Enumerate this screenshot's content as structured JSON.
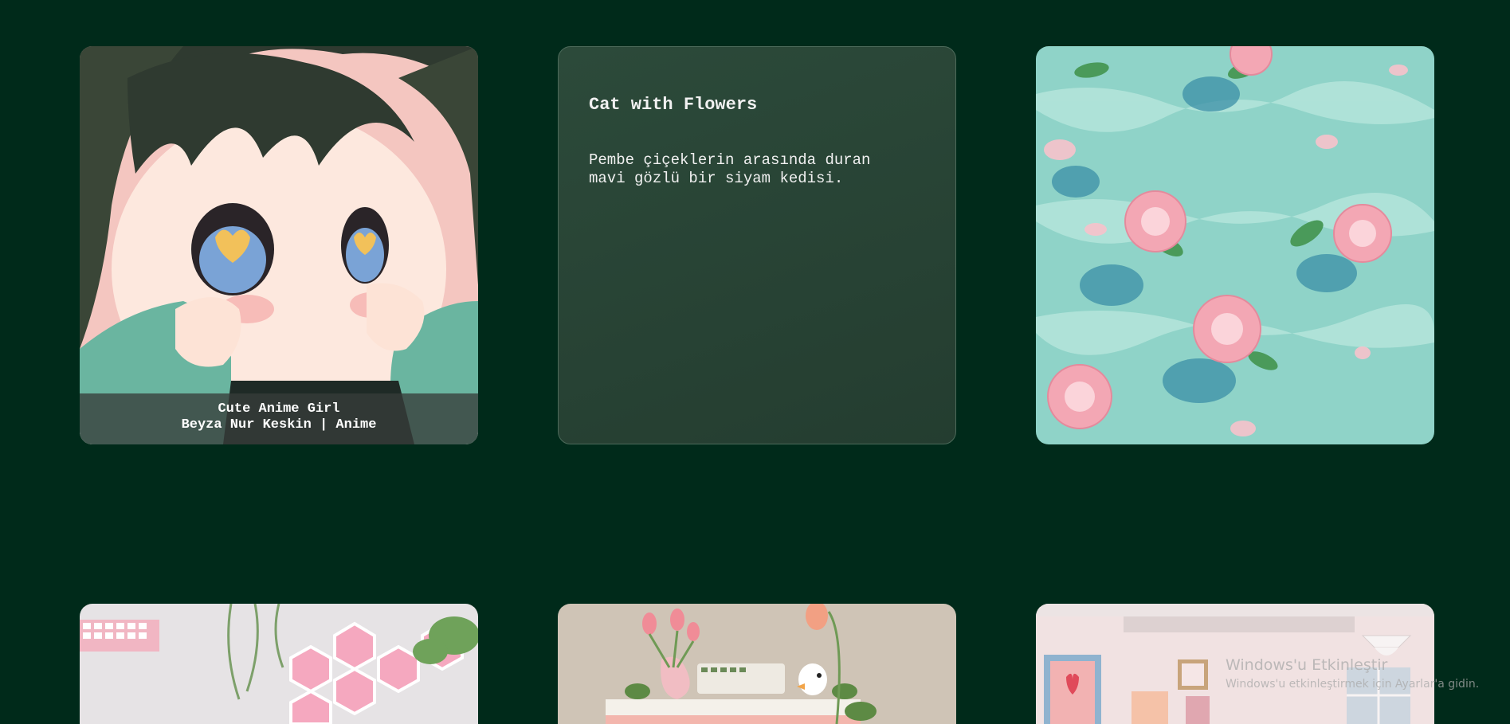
{
  "cards": {
    "anime": {
      "caption_line1": "Cute Anime Girl",
      "caption_line2": "Beyza Nur Keskin | Anime"
    },
    "cat": {
      "title": "Cat with Flowers",
      "description_line1": "Pembe çiçeklerin arasında duran",
      "description_line2": "mavi gözlü bir siyam kedisi."
    }
  },
  "watermark": {
    "line1": "Windows'u Etkinleştir",
    "line2": "Windows'u etkinleştirmek için Ayarlar'a gidin."
  },
  "colors": {
    "page_background": "#002a1a",
    "text_card_background": "#2c4a3a",
    "caption_background": "#373c3a"
  }
}
